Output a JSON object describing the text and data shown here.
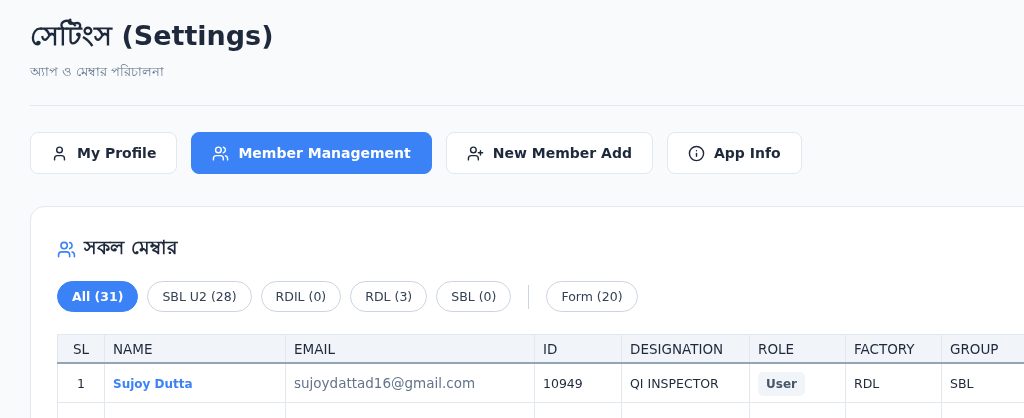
{
  "header": {
    "title": "সেটিংস (Settings)",
    "subtitle": "অ্যাপ ও মেম্বার পরিচালনা"
  },
  "tabs": [
    {
      "label": "My Profile",
      "kind": "profile",
      "selected": false
    },
    {
      "label": "Member Management",
      "kind": "members",
      "selected": true
    },
    {
      "label": "New Member Add",
      "kind": "add",
      "selected": false
    },
    {
      "label": "App Info",
      "kind": "about",
      "selected": false
    }
  ],
  "card": {
    "title": "সকল মেম্বার",
    "filters": [
      {
        "label": "All (31)",
        "selected": true,
        "kind": "group"
      },
      {
        "label": "SBL U2 (28)",
        "selected": false,
        "kind": "group"
      },
      {
        "label": "RDIL (0)",
        "selected": false,
        "kind": "group"
      },
      {
        "label": "RDL (3)",
        "selected": false,
        "kind": "group"
      },
      {
        "label": "SBL (0)",
        "selected": false,
        "kind": "group"
      },
      {
        "label": "Form (20)",
        "selected": false,
        "kind": "separate"
      }
    ],
    "table": {
      "columns": [
        "SL",
        "NAME",
        "EMAIL",
        "ID",
        "DESIGNATION",
        "ROLE",
        "FACTORY",
        "GROUP"
      ],
      "rows": [
        {
          "sl": "1",
          "name": "Sujoy Dutta",
          "email": "sujoydattad16@gmail.com",
          "id": "10949",
          "designation": "QI INSPECTOR",
          "role": "User",
          "factory": "RDL",
          "group": "SBL"
        },
        {}
      ]
    }
  }
}
